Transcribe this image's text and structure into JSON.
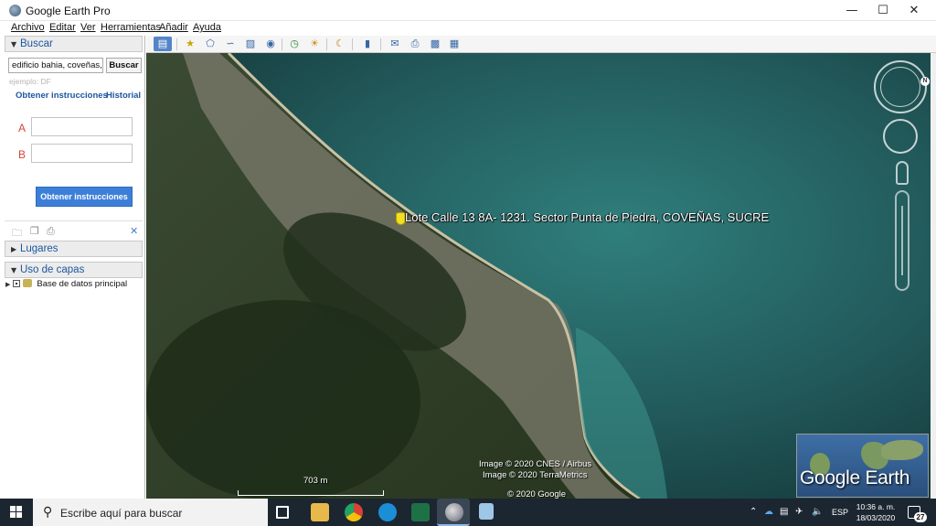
{
  "window": {
    "title": "Google Earth Pro",
    "controls": [
      "minimize",
      "maximize",
      "close"
    ]
  },
  "menu": {
    "items": [
      "Archivo",
      "Editar",
      "Ver",
      "Herramientas",
      "Añadir",
      "Ayuda"
    ]
  },
  "search_panel": {
    "header": "Buscar",
    "query_value": "edificio bahia, coveñas, sucre",
    "search_button": "Buscar",
    "hint": "ejemplo: DF",
    "directions_link": "Obtener instrucciones",
    "history_link": "Historial",
    "point_a": "A",
    "point_b": "B",
    "directions_button": "Obtener instrucciones"
  },
  "places": {
    "header": "Lugares"
  },
  "layers": {
    "header": "Uso de capas",
    "items": [
      "Base de datos principal"
    ]
  },
  "map": {
    "placemark_label": "Lote Calle 13 8A- 1231. Sector Punta de Piedra, COVEÑAS, SUCRE",
    "copyright_1": "Image © 2020 CNES / Airbus",
    "copyright_2": "Image © 2020 TerraMetrics",
    "copyright_3": "© 2020 Google",
    "scale_label": "703 m",
    "overview_logo": "Google Earth",
    "compass_north": "N"
  },
  "taskbar": {
    "search_placeholder": "Escribe aquí para buscar",
    "language": "ESP",
    "time": "10:36 a. m.",
    "date": "18/03/2020",
    "notification_count": "27"
  }
}
